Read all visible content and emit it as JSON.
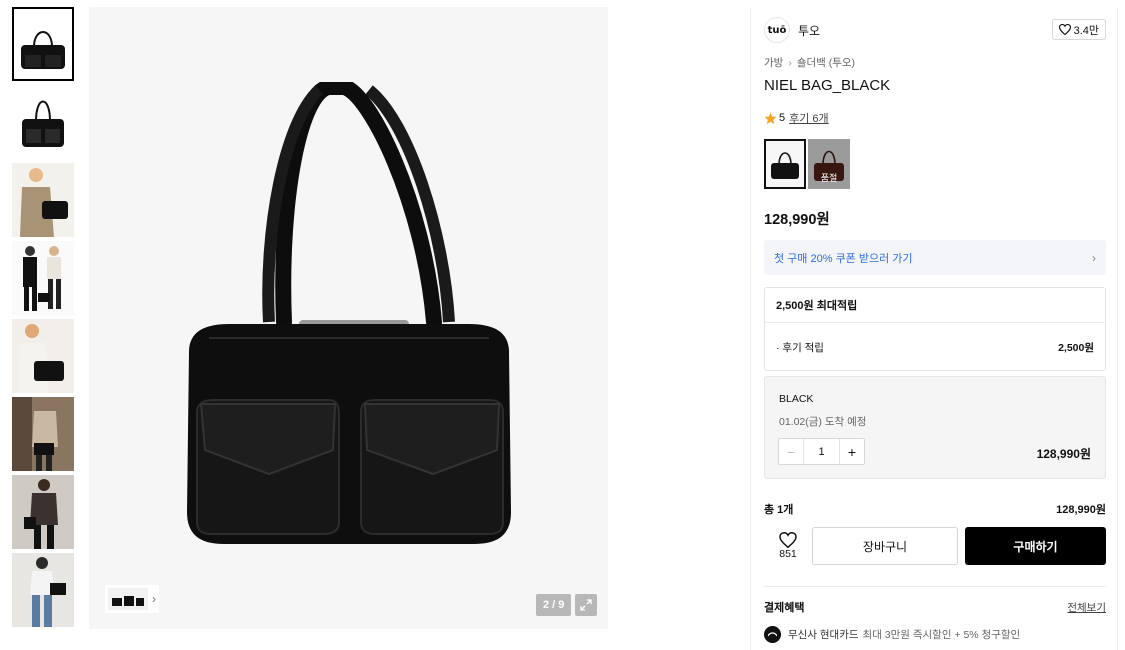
{
  "gallery": {
    "thumbnails": [
      {
        "icon": "bag-front-thumbnail",
        "selected": true
      },
      {
        "icon": "bag-angle-thumbnail",
        "selected": false
      },
      {
        "icon": "model-beige-coat-thumbnail",
        "selected": false
      },
      {
        "icon": "two-models-thumbnail",
        "selected": false
      },
      {
        "icon": "model-shoulder-thumbnail",
        "selected": false
      },
      {
        "icon": "model-mirror-thumbnail",
        "selected": false
      },
      {
        "icon": "model-street-thumbnail",
        "selected": false
      },
      {
        "icon": "model-jeans-thumbnail",
        "selected": false
      }
    ],
    "pager": "2 / 9",
    "mini_strip_arrow": "›"
  },
  "brand": {
    "logo_text": "tuō",
    "name": "투오",
    "likes": "3.4만"
  },
  "breadcrumb": {
    "items": [
      "가방",
      "숄더백 (투오)"
    ],
    "separator": "›"
  },
  "product": {
    "title": "NIEL BAG_BLACK",
    "rating": "5",
    "reviews": "후기 6개",
    "swatch_soldout": "품절",
    "price": "128,990원"
  },
  "coupon": {
    "text": "첫 구매 20% 쿠폰 받으러 가기",
    "chevron": "›"
  },
  "points": {
    "header": "2,500원 최대적립",
    "row_label": "· 후기 적립",
    "row_value": "2,500원"
  },
  "option": {
    "name": "BLACK",
    "delivery": "01.02(금) 도착 예정",
    "minus": "−",
    "quantity": "1",
    "plus": "+",
    "price": "128,990원"
  },
  "total": {
    "label": "총 1개",
    "value": "128,990원"
  },
  "actions": {
    "wish_count": "851",
    "cart_label": "장바구니",
    "buy_label": "구매하기"
  },
  "benefits": {
    "title": "결제혜택",
    "more": "전체보기",
    "card_name": "무신사 현대카드",
    "card_desc": "최대 3만원 즉시할인 + 5% 청구할인"
  },
  "colors": {
    "accent_blue": "#2f6ee0",
    "star": "#f5a623",
    "buy_button": "#000000"
  }
}
